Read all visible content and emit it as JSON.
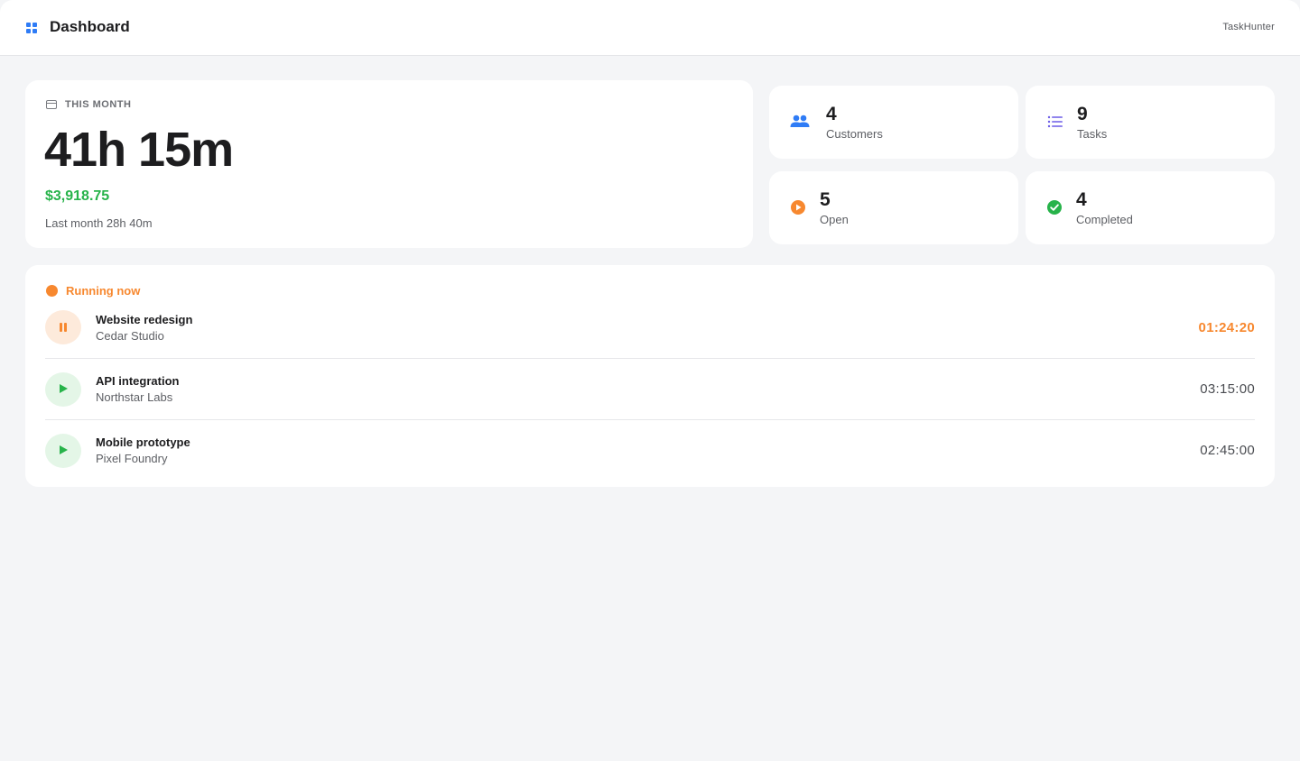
{
  "header": {
    "title": "Dashboard",
    "brand": "TaskHunter",
    "accent_color": "#2f7cf6"
  },
  "this_month": {
    "label": "THIS MONTH",
    "icon": "calendar-icon",
    "hours": "41h 15m",
    "amount": "$3,918.75",
    "last_month": "Last month 28h 40m"
  },
  "stats": {
    "customers": {
      "value": "4",
      "label": "Customers",
      "icon": "users-icon",
      "color": "#2f7cf6"
    },
    "tasks": {
      "value": "9",
      "label": "Tasks",
      "icon": "list-icon",
      "color": "#6b5ce7"
    },
    "open": {
      "value": "5",
      "label": "Open",
      "icon": "play-circle-icon",
      "color": "#f7882f"
    },
    "completed": {
      "value": "4",
      "label": "Completed",
      "icon": "check-circle-icon",
      "color": "#27b34a"
    }
  },
  "running": {
    "title": "Running now",
    "items": [
      {
        "name": "Website redesign",
        "client": "Cedar Studio",
        "time": "01:24:20",
        "state": "pause"
      },
      {
        "name": "API integration",
        "client": "Northstar Labs",
        "time": "03:15:00",
        "state": "play"
      },
      {
        "name": "Mobile prototype",
        "client": "Pixel Foundry",
        "time": "02:45:00",
        "state": "play"
      }
    ]
  }
}
